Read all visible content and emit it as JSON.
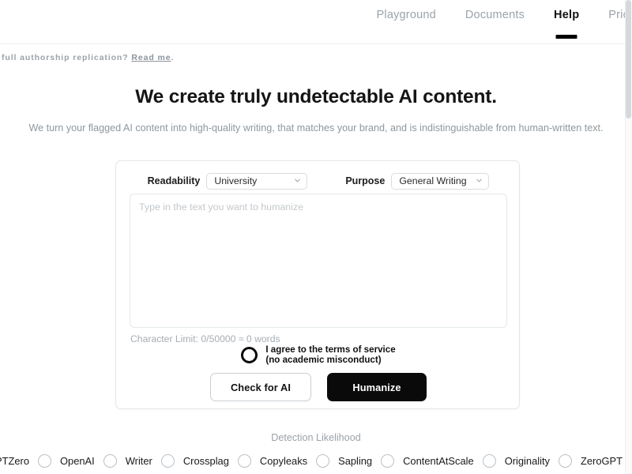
{
  "nav": {
    "links": [
      {
        "label": "Playground",
        "active": false
      },
      {
        "label": "Documents",
        "active": false
      },
      {
        "label": "Help",
        "active": true
      },
      {
        "label": "Pricing",
        "active": false
      }
    ]
  },
  "banner": {
    "text": "full authorship replication?",
    "link_label": "Read me",
    "suffix": "."
  },
  "hero": {
    "title": "We create truly undetectable AI content.",
    "subtitle": "We turn your flagged AI content into high-quality writing, that matches your brand, and is indistinguishable from human-written text."
  },
  "form": {
    "readability_label": "Readability",
    "readability_value": "University",
    "purpose_label": "Purpose",
    "purpose_value": "General Writing",
    "textarea_placeholder": "Type in the text you want to humanize",
    "textarea_value": "",
    "character_limit": "Character Limit: 0/50000 ≈ 0 words",
    "terms_line1": "I agree to the terms of service",
    "terms_line2": "(no academic misconduct)",
    "check_button": "Check for AI",
    "humanize_button": "Humanize"
  },
  "detection": {
    "title": "Detection Likelihood",
    "detectors": [
      "GPTZero",
      "OpenAI",
      "Writer",
      "Crossplag",
      "Copyleaks",
      "Sapling",
      "ContentAtScale",
      "Originality",
      "ZeroGPT"
    ]
  },
  "colors": {
    "accent_black": "#0a0a0a",
    "muted_text": "#9aa3ab",
    "border": "#e3e6e8"
  }
}
